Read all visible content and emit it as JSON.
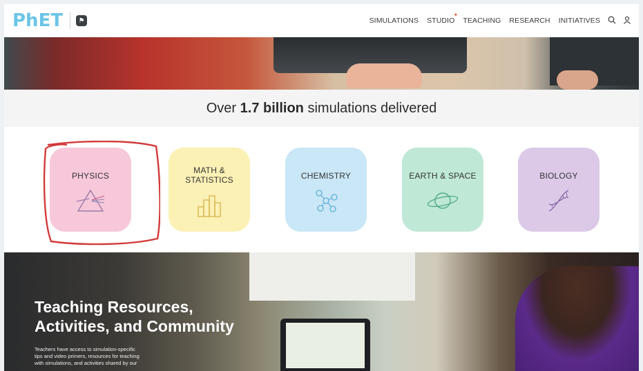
{
  "header": {
    "logo_text": "PhET",
    "nav": {
      "simulations": "SIMULATIONS",
      "studio": "STUDIO",
      "teaching": "TEACHING",
      "research": "RESEARCH",
      "initiatives": "INITIATIVES"
    },
    "icons": [
      "search-icon",
      "user-icon"
    ]
  },
  "stat": {
    "prefix": "Over ",
    "highlight": "1.7 billion",
    "suffix": " simulations delivered"
  },
  "subjects": [
    {
      "label": "PHYSICS",
      "color": "#f7c8da",
      "icon": "prism-icon"
    },
    {
      "label": "MATH & STATISTICS",
      "line1": "MATH &",
      "line2": "STATISTICS",
      "color": "#fbf1b5",
      "icon": "bar-chart-icon"
    },
    {
      "label": "CHEMISTRY",
      "color": "#c9e7f6",
      "icon": "molecule-icon"
    },
    {
      "label": "EARTH & SPACE",
      "color": "#bfe8d6",
      "icon": "planet-icon"
    },
    {
      "label": "BIOLOGY",
      "color": "#dcc9e8",
      "icon": "dna-icon"
    }
  ],
  "teaching": {
    "heading_line1": "Teaching Resources,",
    "heading_line2": "Activities, and Community",
    "body_line1": "Teachers have access to simulation-specific",
    "body_line2": "tips and video primers, resources for teaching",
    "body_line3": "with simulations, and activities shared by our"
  },
  "colors": {
    "logo": "#6cc5e8",
    "annotation": "#d23a3a"
  }
}
